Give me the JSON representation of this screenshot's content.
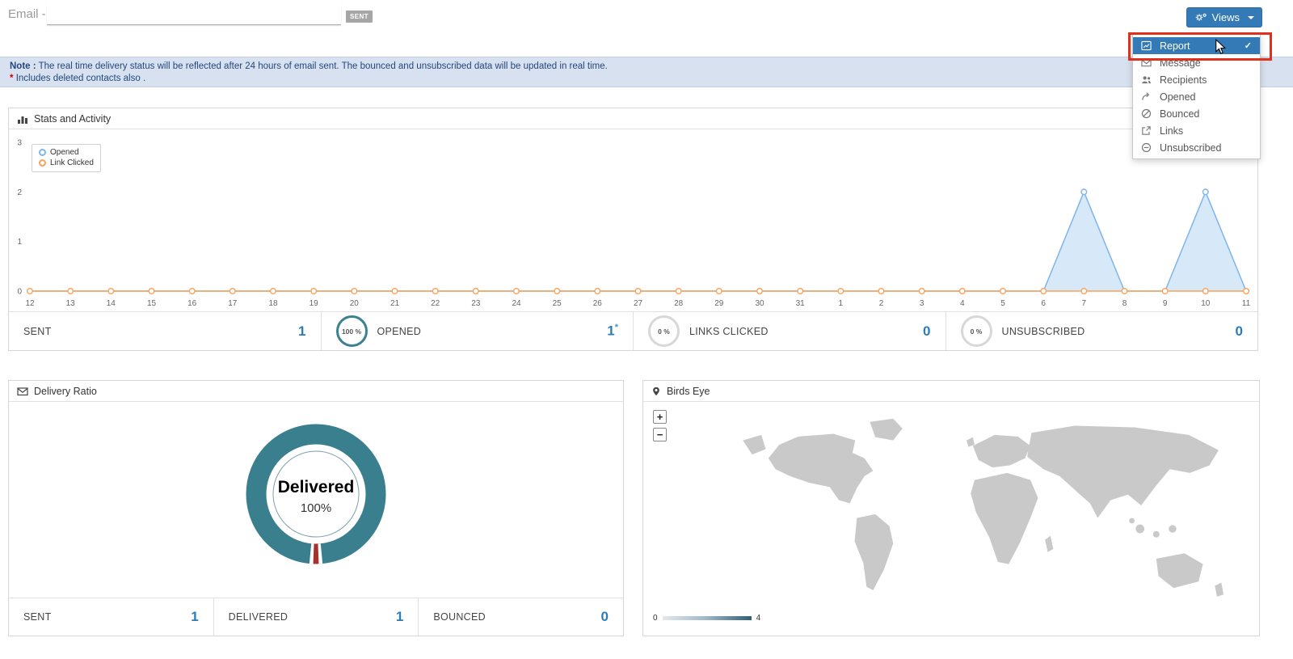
{
  "header": {
    "email_label": "Email -",
    "email_value": "",
    "sent_badge": "SENT",
    "views_label": "Views"
  },
  "dropdown": {
    "items": [
      {
        "label": "Report",
        "selected": true
      },
      {
        "label": "Message",
        "selected": false
      },
      {
        "label": "Recipients",
        "selected": false
      },
      {
        "label": "Opened",
        "selected": false
      },
      {
        "label": "Bounced",
        "selected": false
      },
      {
        "label": "Links",
        "selected": false
      },
      {
        "label": "Unsubscribed",
        "selected": false
      }
    ],
    "check_glyph": "✓"
  },
  "note": {
    "label": "Note :",
    "text": "The real time delivery status will be reflected after 24 hours of email sent. The bounced and unsubscribed data will be updated in real time.",
    "footnote_star": "*",
    "footnote": "Includes deleted contacts also ."
  },
  "stats_panel": {
    "title": "Stats and Activity",
    "stats": [
      {
        "label": "SENT",
        "value": "1"
      },
      {
        "badge": "100 %",
        "label": "OPENED",
        "value": "1",
        "value_suffix": "*"
      },
      {
        "badge": "0 %",
        "label": "LINKS CLICKED",
        "value": "0"
      },
      {
        "badge": "0 %",
        "label": "UNSUBSCRIBED",
        "value": "0"
      }
    ]
  },
  "delivery_panel": {
    "title": "Delivery Ratio",
    "center_label": "Delivered",
    "center_value": "100%",
    "stats": [
      {
        "label": "SENT",
        "value": "1"
      },
      {
        "label": "DELIVERED",
        "value": "1"
      },
      {
        "label": "BOUNCED",
        "value": "0"
      }
    ]
  },
  "map_panel": {
    "title": "Birds Eye",
    "zoom_in": "+",
    "zoom_out": "−",
    "legend_min": "0",
    "legend_max": "4"
  },
  "colors": {
    "accent_blue": "#337ab7",
    "value_blue": "#2b7cb9",
    "teal_ring": "#397f8e",
    "bounced_red": "#a5342e",
    "annotation_red": "#e0301e",
    "note_bg": "#d8e1ef",
    "map_gray": "#c9c9c9"
  },
  "chart_data": [
    {
      "type": "line",
      "title": "Stats and Activity",
      "x": [
        "12",
        "13",
        "14",
        "15",
        "16",
        "17",
        "18",
        "19",
        "20",
        "21",
        "22",
        "23",
        "24",
        "25",
        "26",
        "27",
        "28",
        "29",
        "30",
        "31",
        "1",
        "2",
        "3",
        "4",
        "5",
        "6",
        "7",
        "8",
        "9",
        "10",
        "11"
      ],
      "series": [
        {
          "name": "Opened",
          "color": "#7cb5ec",
          "fill": "rgba(124,181,236,0.30)",
          "values": [
            0,
            0,
            0,
            0,
            0,
            0,
            0,
            0,
            0,
            0,
            0,
            0,
            0,
            0,
            0,
            0,
            0,
            0,
            0,
            0,
            0,
            0,
            0,
            0,
            0,
            0,
            2,
            0,
            0,
            2,
            0
          ]
        },
        {
          "name": "Link Clicked",
          "color": "#f7a35c",
          "fill": "none",
          "values": [
            0,
            0,
            0,
            0,
            0,
            0,
            0,
            0,
            0,
            0,
            0,
            0,
            0,
            0,
            0,
            0,
            0,
            0,
            0,
            0,
            0,
            0,
            0,
            0,
            0,
            0,
            0,
            0,
            0,
            0,
            0
          ]
        }
      ],
      "ylim": [
        0,
        3
      ],
      "yticks": [
        0,
        1,
        2,
        3
      ],
      "legend_position": "top-left",
      "grid": false
    },
    {
      "type": "pie",
      "title": "Delivery Ratio",
      "labels": [
        "Delivered",
        "Bounced"
      ],
      "values": [
        100,
        0
      ],
      "colors": [
        "#397f8e",
        "#a5342e"
      ]
    }
  ]
}
